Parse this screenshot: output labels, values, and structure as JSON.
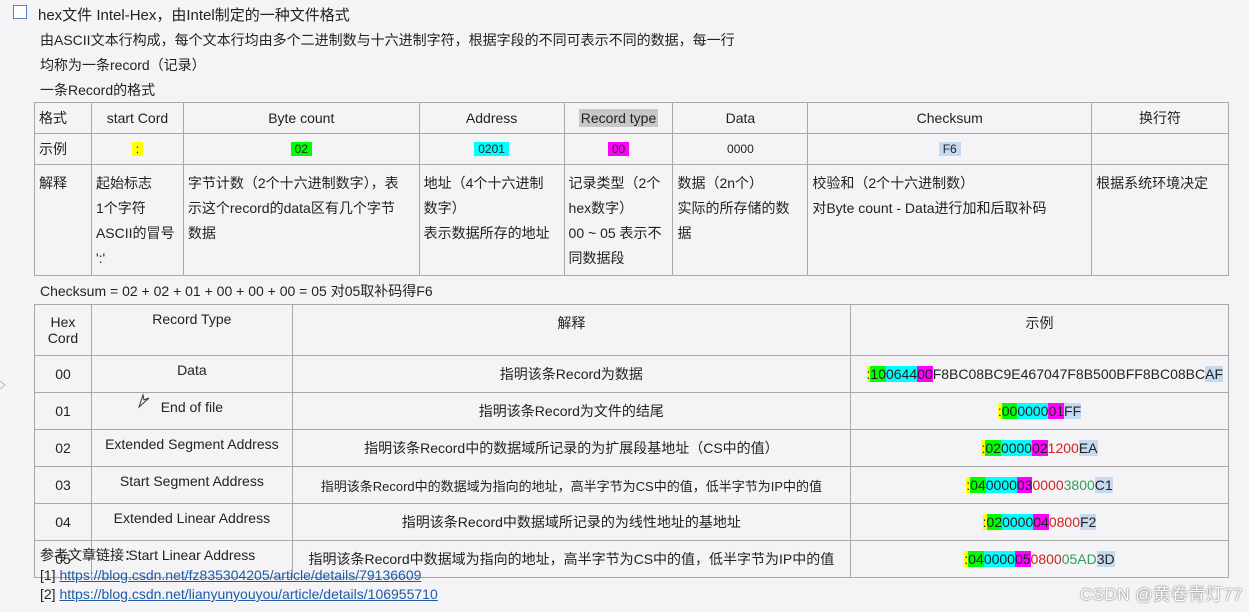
{
  "title": "hex文件 Intel-Hex，由Intel制定的一种文件格式",
  "intro_line1": "由ASCII文本行构成，每个文本行均由多个二进制数与十六进制字符，根据字段的不同可表示不同的数据，每一行",
  "intro_line2": "均称为一条record（记录）",
  "format_subtitle": "一条Record的格式",
  "format_table": {
    "headers": [
      "格式",
      "start Cord",
      "Byte count",
      "Address",
      "Record type",
      "Data",
      "Checksum",
      "换行符"
    ],
    "example_label": "示例",
    "examples": [
      ":",
      "02",
      "0201",
      "00",
      "0000",
      "F6",
      ""
    ],
    "explain_label": "解释",
    "explains": [
      [
        "起始标志",
        "1个字符",
        "ASCII的冒号",
        "':'"
      ],
      [
        "字节计数（2个十六进制数字），表",
        "示这个record的data区有几个字节",
        "数据"
      ],
      [
        "地址（4个十六进制",
        "数字）",
        "表示数据所存的地址"
      ],
      [
        "记录类型（2个",
        "hex数字）",
        "00 ~ 05 表示不",
        "同数据段"
      ],
      [
        "数据（2n个）",
        "实际的所存储的数",
        "据"
      ],
      [
        "校验和（2个十六进制数）",
        "对Byte count - Data进行加和后取补码"
      ],
      [
        "根据系统环境决定"
      ]
    ]
  },
  "checksum_note": "Checksum = 02 + 02 + 01 + 00 + 00 + 00 = 05 对05取补码得F6",
  "record_table": {
    "headers": [
      "Hex Cord",
      "Record Type",
      "解释",
      "示例"
    ],
    "rows": [
      {
        "code": "00",
        "type": "Data",
        "desc": "指明该条Record为数据",
        "ex": [
          ":",
          "10",
          "0644",
          "00",
          "F8BC08BC9E467047F8B500BFF8BC08BC",
          "AF"
        ]
      },
      {
        "code": "01",
        "type": "End of file",
        "desc": "指明该条Record为文件的结尾",
        "ex": [
          ":",
          "00",
          "0000",
          "01",
          "",
          "FF"
        ]
      },
      {
        "code": "02",
        "type": "Extended Segment Address",
        "desc": "指明该条Record中的数据域所记录的为扩展段基地址（CS中的值）",
        "ex": [
          ":",
          "02",
          "0000",
          "02",
          "1200",
          "EA"
        ]
      },
      {
        "code": "03",
        "type": "Start Segment Address",
        "desc": "指明该条Record中的数据域为指向的地址，高半字节为CS中的值，低半字节为IP中的值",
        "ex": [
          ":",
          "04",
          "0000",
          "03",
          "0000",
          "3800",
          "C1"
        ]
      },
      {
        "code": "04",
        "type": "Extended Linear Address",
        "desc": "指明该条Record中数据域所记录的为线性地址的基地址",
        "ex": [
          ":",
          "02",
          "0000",
          "04",
          "0800",
          "F2"
        ]
      },
      {
        "code": "05",
        "type": "Start Linear Address",
        "desc": "指明该条Record中数据域为指向的地址，高半字节为CS中的值，低半字节为IP中的值",
        "ex": [
          ":",
          "04",
          "0000",
          "05",
          "0800",
          "05AD",
          "3D"
        ]
      }
    ]
  },
  "references_label": "参考文章链接：",
  "links": [
    {
      "prefix": "[1] ",
      "url": "https://blog.csdn.net/fz835304205/article/details/79136609"
    },
    {
      "prefix": "[2] ",
      "url": "https://blog.csdn.net/lianyunyouyou/article/details/106955710"
    }
  ],
  "watermark": "CSDN @黄卷青灯77",
  "colors": {
    "yellow": "#ffff00",
    "green": "#00ff00",
    "cyan": "#00ffff",
    "magenta": "#ff00ff",
    "checksum_blue": "#c5d9f1",
    "link": "#1f5aa6"
  }
}
